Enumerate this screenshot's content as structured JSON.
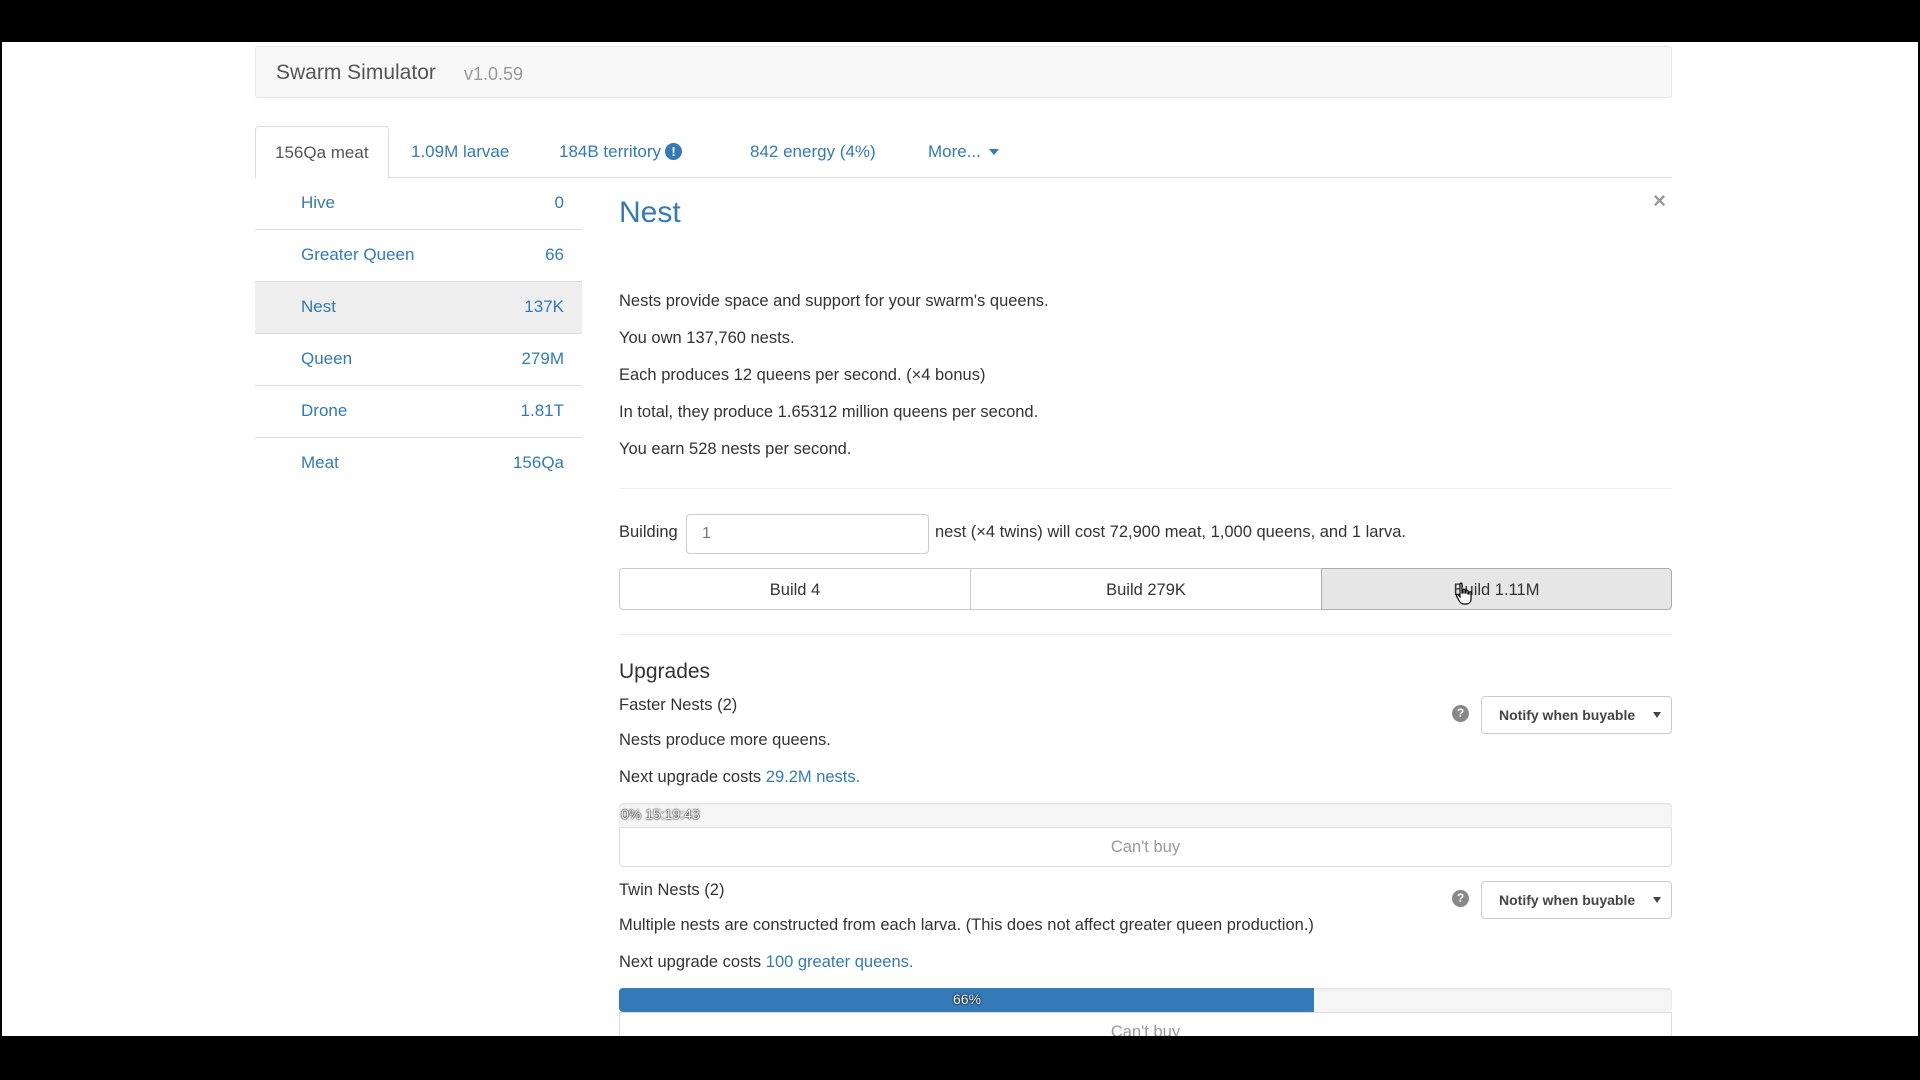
{
  "app": {
    "brand": "Swarm Simulator",
    "version": "v1.0.59"
  },
  "tabs": [
    {
      "label": "156Qa meat"
    },
    {
      "label": "1.09M larvae"
    },
    {
      "label": "184B territory"
    },
    {
      "label": "842 energy (4%)"
    },
    {
      "label": "More..."
    }
  ],
  "sidebar": {
    "items": [
      {
        "label": "Hive",
        "count": "0"
      },
      {
        "label": "Greater Queen",
        "count": "66"
      },
      {
        "label": "Nest",
        "count": "137K"
      },
      {
        "label": "Queen",
        "count": "279M"
      },
      {
        "label": "Drone",
        "count": "1.81T"
      },
      {
        "label": "Meat",
        "count": "156Qa"
      }
    ]
  },
  "detail": {
    "close": "×",
    "title": "Nest",
    "lines": [
      "Nests provide space and support for your swarm's queens.",
      "You own 137,760 nests.",
      "Each produces 12 queens per second. (×4 bonus)",
      "In total, they produce 1.65312 million queens per second.",
      "You earn 528 nests per second."
    ],
    "build": {
      "label": "Building",
      "input_value": "1",
      "after": "nest (×4 twins) will cost 72,900 meat, 1,000 queens, and 1 larva.",
      "buttons": [
        "Build 4",
        "Build 279K",
        "Build 1.11M"
      ]
    }
  },
  "upgrades": {
    "heading": "Upgrades",
    "items": [
      {
        "name": "Faster Nests (2)",
        "desc": "Nests produce more queens.",
        "cost_prefix": "Next upgrade costs",
        "cost_link": "29.2M nests.",
        "progress": 0,
        "progress_text": "0% 15:19:43",
        "notify": "Notify when buyable",
        "button": "Can't buy"
      },
      {
        "name": "Twin Nests (2)",
        "desc": "Multiple nests are constructed from each larva. (This does not affect greater queen production.)",
        "cost_prefix": "Next upgrade costs",
        "cost_link": "100 greater queens.",
        "progress": 66,
        "progress_text": "66%",
        "notify": "Notify when buyable",
        "button": "Can't buy"
      }
    ]
  },
  "colors": {
    "link": "#337ab7",
    "progress": "#337ab7"
  },
  "icons": {
    "info": "info-circle-icon",
    "help": "question-circle-icon",
    "cursor": "hand-pointer-icon"
  }
}
